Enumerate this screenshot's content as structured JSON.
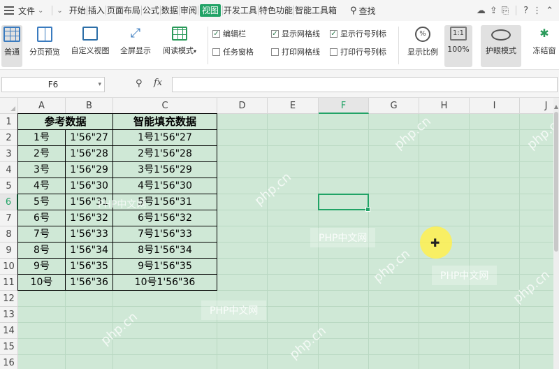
{
  "menu": {
    "file_label": "文件",
    "tabs": [
      "开始",
      "插入",
      "页面布局",
      "公式",
      "数据",
      "审阅",
      "视图",
      "开发工具",
      "特色功能",
      "智能工具箱"
    ],
    "active_tab_index": 6,
    "find_label": "查找",
    "right_icons": [
      "cloud-sync-icon",
      "share-icon",
      "export-icon",
      "help-icon",
      "more-icon",
      "collapse-icon"
    ]
  },
  "ribbon": {
    "buttons": [
      {
        "label": "普通",
        "icon": "normal-view-icon",
        "selected": true
      },
      {
        "label": "分页预览",
        "icon": "page-break-icon",
        "selected": false
      },
      {
        "label": "自定义视图",
        "icon": "custom-view-icon",
        "selected": false
      },
      {
        "label": "全屏显示",
        "icon": "fullscreen-icon",
        "selected": false
      },
      {
        "label": "阅读模式",
        "icon": "reading-mode-icon",
        "selected": false
      }
    ],
    "checks": [
      {
        "label": "编辑栏",
        "checked": true
      },
      {
        "label": "任务窗格",
        "checked": false
      },
      {
        "label": "显示网格线",
        "checked": true
      },
      {
        "label": "打印网格线",
        "checked": false
      },
      {
        "label": "显示行号列标",
        "checked": true
      },
      {
        "label": "打印行号列标",
        "checked": false
      }
    ],
    "zoom_label": "显示比例",
    "zoom_value": "100%",
    "zoom_box": "1:1",
    "eye_label": "护眼模式",
    "freeze_label": "冻结窗"
  },
  "formula_bar": {
    "name_box": "F6",
    "fx": "fx",
    "value": ""
  },
  "sheet": {
    "columns": [
      "A",
      "B",
      "C",
      "D",
      "E",
      "F",
      "G",
      "H",
      "I",
      "J"
    ],
    "rows": [
      "1",
      "2",
      "3",
      "4",
      "5",
      "6",
      "7",
      "8",
      "9",
      "10",
      "11",
      "12",
      "13",
      "14",
      "15",
      "16"
    ],
    "selected_col": "F",
    "selected_row": "6",
    "header": {
      "A": "参考数据",
      "C": "智能填充数据"
    },
    "data": [
      [
        "1号",
        "1'56\"27",
        "1号1'56\"27"
      ],
      [
        "2号",
        "1'56\"28",
        "2号1'56\"28"
      ],
      [
        "3号",
        "1'56\"29",
        "3号1'56\"29"
      ],
      [
        "4号",
        "1'56\"30",
        "4号1'56\"30"
      ],
      [
        "5号",
        "1'56\"31",
        "5号1'56\"31"
      ],
      [
        "6号",
        "1'56\"32",
        "6号1'56\"32"
      ],
      [
        "7号",
        "1'56\"33",
        "7号1'56\"33"
      ],
      [
        "8号",
        "1'56\"34",
        "8号1'56\"34"
      ],
      [
        "9号",
        "1'56\"35",
        "9号1'56\"35"
      ],
      [
        "10号",
        "1'56\"36",
        "10号1'56\"36"
      ]
    ]
  },
  "watermarks": [
    "PHP中文网",
    "php.cn"
  ],
  "colors": {
    "accent": "#21a366",
    "sheet_bg": "#cfe8d6"
  }
}
